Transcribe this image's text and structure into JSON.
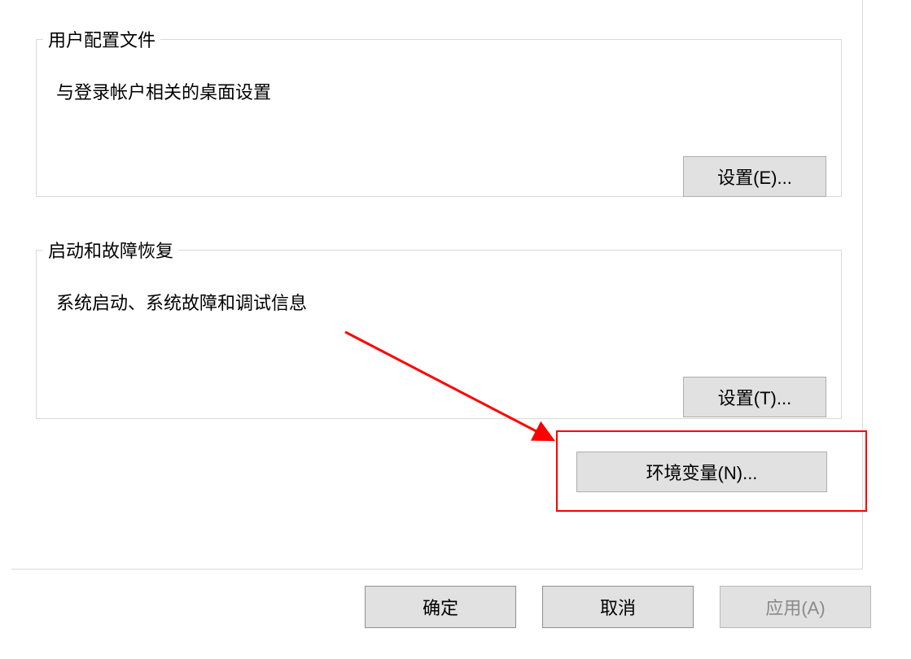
{
  "groups": {
    "user_profile": {
      "legend": "用户配置文件",
      "description": "与登录帐户相关的桌面设置",
      "settings_button": "设置(E)..."
    },
    "startup_recovery": {
      "legend": "启动和故障恢复",
      "description": "系统启动、系统故障和调试信息",
      "settings_button": "设置(T)..."
    }
  },
  "env_button": "环境变量(N)...",
  "footer": {
    "ok": "确定",
    "cancel": "取消",
    "apply": "应用(A)"
  }
}
